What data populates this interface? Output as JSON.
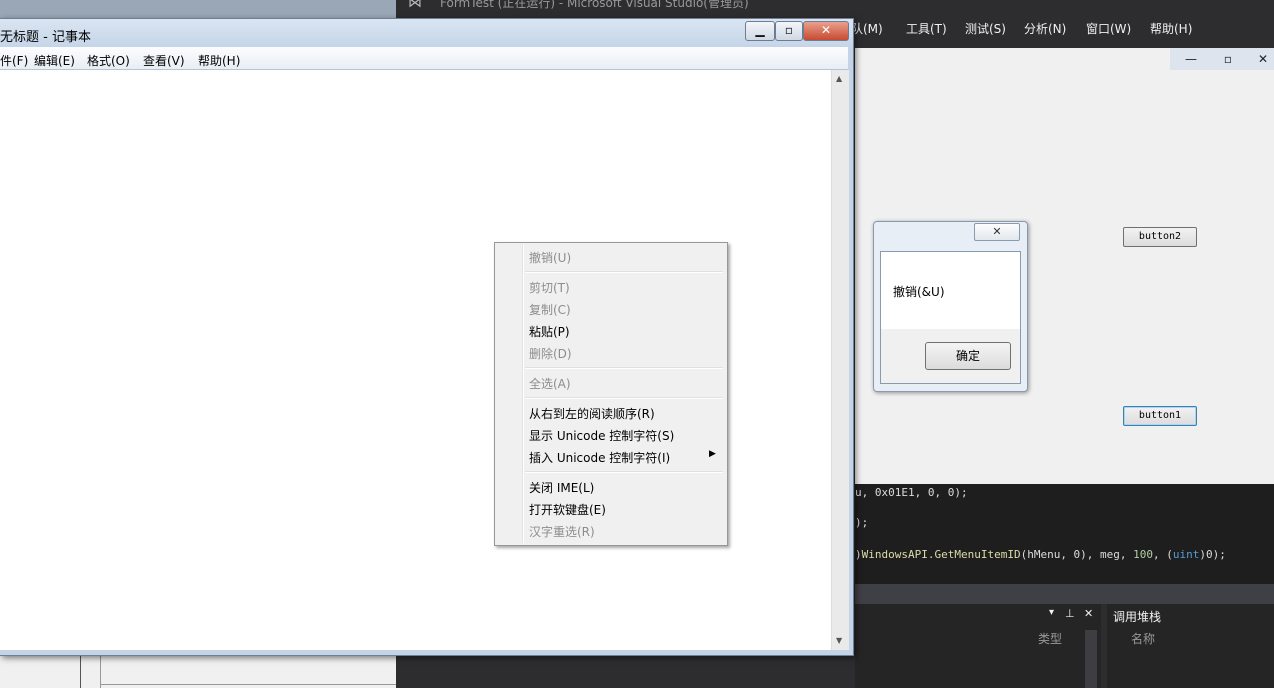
{
  "vs": {
    "title": "FormTest (正在运行) - Microsoft Visual Studio(管理员)",
    "menus": [
      "队(M)",
      "工具(T)",
      "测试(S)",
      "分析(N)",
      "窗口(W)",
      "帮助(H)"
    ]
  },
  "form": {
    "button2_label": "button2",
    "button1_label": "button1"
  },
  "msgbox": {
    "text": "撤销(&U)",
    "ok_label": "确定"
  },
  "code": {
    "line1": "u, 0x01E1, 0, 0);",
    "line2": ");",
    "line3_prefix": ")",
    "line3_fn": "WindowsAPI.GetMenuItemID",
    "line3_args": "(hMenu, 0), meg, ",
    "line3_num": "100",
    "line3_sep": ", (",
    "line3_type": "uint",
    "line3_end": ")0);"
  },
  "panels": {
    "type_header": "类型",
    "call_stack_title": "调用堆栈",
    "name_header": "名称"
  },
  "notepad": {
    "title": "无标题 - 记事本",
    "menus": [
      "件(F)",
      "编辑(E)",
      "格式(O)",
      "查看(V)",
      "帮助(H)"
    ]
  },
  "context_menu": {
    "items": [
      {
        "label": "撤销(U)",
        "enabled": false
      },
      {
        "label": "剪切(T)",
        "enabled": false
      },
      {
        "label": "复制(C)",
        "enabled": false
      },
      {
        "label": "粘贴(P)",
        "enabled": true
      },
      {
        "label": "删除(D)",
        "enabled": false
      },
      {
        "label": "全选(A)",
        "enabled": false
      },
      {
        "label": "从右到左的阅读顺序(R)",
        "enabled": true
      },
      {
        "label": "显示 Unicode 控制字符(S)",
        "enabled": true
      },
      {
        "label": "插入 Unicode 控制字符(I)",
        "enabled": true,
        "submenu": true
      },
      {
        "label": "关闭 IME(L)",
        "enabled": true
      },
      {
        "label": "打开软键盘(E)",
        "enabled": true
      },
      {
        "label": "汉字重选(R)",
        "enabled": false
      }
    ]
  }
}
